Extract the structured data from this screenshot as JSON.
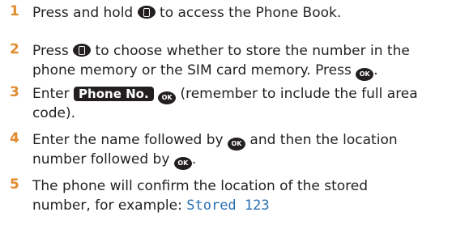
{
  "steps": [
    {
      "number": "1",
      "lines": [
        {
          "before": "Press and hold ",
          "icon": "phonebook-icon",
          "after": " to access the Phone Book."
        }
      ]
    },
    {
      "number": "2",
      "lines": [
        {
          "before": "Press ",
          "icon": "navigation-icon",
          "after": " to choose whether to store the number in the"
        },
        {
          "before": "phone memory or the SIM card memory. Press ",
          "icon": "ok-icon",
          "after": "."
        }
      ]
    },
    {
      "number": "3",
      "lines": [
        {
          "before": "Enter ",
          "softkey": "Phone No.",
          "icon": "ok-icon",
          "after": " (remember to include the full area"
        },
        {
          "before": "code).",
          "icon": null,
          "after": ""
        }
      ]
    },
    {
      "number": "4",
      "lines": [
        {
          "before": "Enter the name followed by ",
          "icon": "ok-icon",
          "after": " and then the location"
        },
        {
          "before": "number followed by ",
          "icon": "ok-icon",
          "after": "."
        }
      ]
    },
    {
      "number": "5",
      "lines": [
        {
          "before": "The phone will confirm the location of the stored",
          "icon": null,
          "after": ""
        },
        {
          "before": "number, for example: ",
          "icon": null,
          "after": "",
          "display": "Stored 123"
        }
      ]
    }
  ],
  "ok_label": "OK",
  "colors": {
    "step_number": "#e08a2c",
    "display_text": "#2a6fb0",
    "icon_bg": "#231f20"
  }
}
